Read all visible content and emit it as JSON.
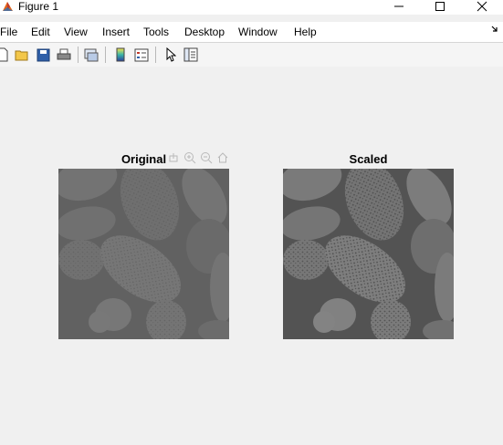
{
  "window": {
    "title": "Figure 1",
    "icons": {
      "app": "matlab-logo-icon",
      "minimize": "minimize-icon",
      "maximize": "maximize-icon",
      "close": "close-icon"
    }
  },
  "menu": {
    "items": [
      "File",
      "Edit",
      "View",
      "Insert",
      "Tools",
      "Desktop",
      "Window",
      "Help"
    ],
    "dock_icon": "dock-arrow-icon"
  },
  "toolbar": {
    "buttons": [
      "new-figure-icon",
      "open-file-icon",
      "save-figure-icon",
      "print-figure-icon",
      "link-plot-icon",
      "insert-colorbar-icon",
      "insert-legend-icon",
      "edit-plot-icon",
      "property-inspector-icon"
    ]
  },
  "figure": {
    "axes": [
      {
        "title": "Original"
      },
      {
        "title": "Scaled"
      }
    ],
    "axes_toolbar": [
      "export-icon",
      "zoom-in-icon",
      "zoom-out-icon",
      "home-icon"
    ]
  },
  "colors": {
    "background": "#f0f0f0",
    "original_image_tone": "#6a6a6a",
    "scaled_image_tone": "#6d6d6d"
  }
}
